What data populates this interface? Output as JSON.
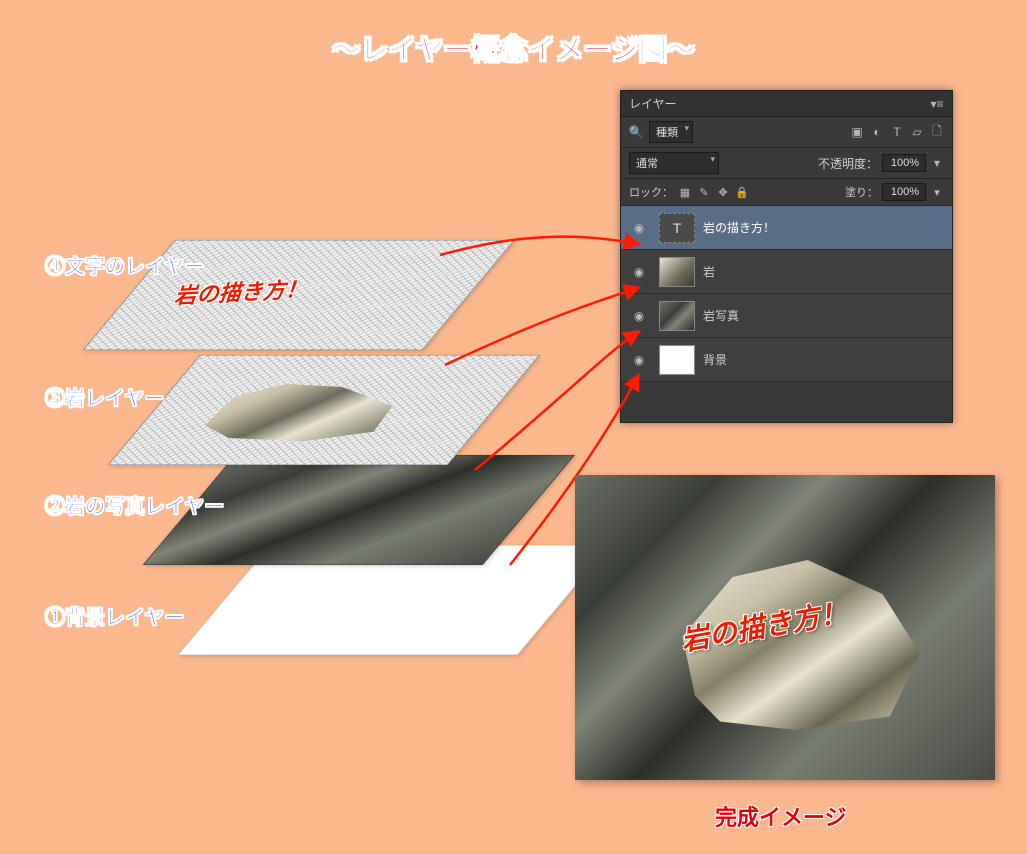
{
  "title": "～レイヤー概念イメージ図～",
  "labels": {
    "textLayer": "④文字のレイヤー",
    "rockLayer": "③岩レイヤー",
    "photoLayer": "②岩の写真レイヤー",
    "bgLayer": "①背景レイヤー"
  },
  "sampleText": "岩の描き方！",
  "panel": {
    "title": "レイヤー",
    "filterLabel": "種類",
    "blendMode": "通常",
    "opacityLabel": "不透明度：",
    "opacityValue": "100%",
    "lockLabel": "ロック：",
    "fillLabel": "塗り：",
    "fillValue": "100%",
    "layers": [
      {
        "name": "岩の描き方！",
        "type": "text",
        "selected": true
      },
      {
        "name": "岩",
        "type": "rock",
        "selected": false
      },
      {
        "name": "岩写真",
        "type": "rockphoto",
        "selected": false
      },
      {
        "name": "背景",
        "type": "white",
        "selected": false
      }
    ]
  },
  "finalLabel": "完成イメージ",
  "colors": {
    "background": "#fbb88d",
    "titleRed": "#e6000d",
    "labelBlue": "#001fe6",
    "arrowRed": "#ff1a00"
  }
}
